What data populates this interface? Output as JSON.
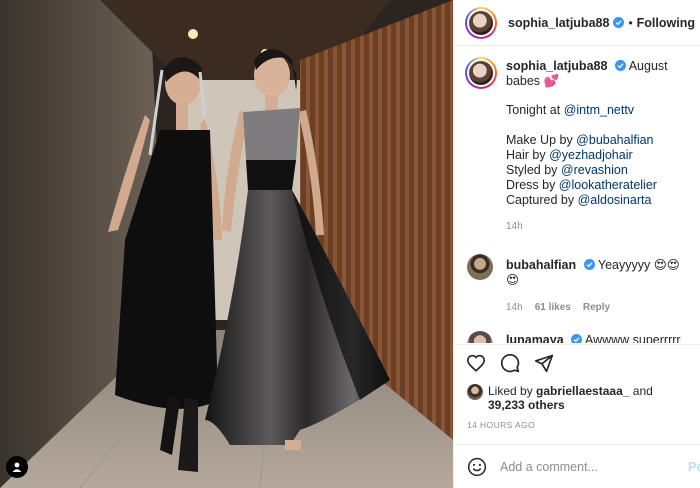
{
  "post": {
    "author": "sophia_latjuba88",
    "follow_status": "Following",
    "separator": "•"
  },
  "caption": {
    "username": "sophia_latjuba88",
    "title": "August babes 💕",
    "line_tonight_prefix": "Tonight at ",
    "line_tonight_mention": "@intm_nettv",
    "credits": [
      {
        "prefix": "Make Up by ",
        "mention": "@bubahalfian"
      },
      {
        "prefix": "Hair by ",
        "mention": "@yezhadjohair"
      },
      {
        "prefix": "Styled by ",
        "mention": "@revashion"
      },
      {
        "prefix": "Dress by ",
        "mention": "@lookatheratelier"
      },
      {
        "prefix": "Captured by ",
        "mention": "@aldosinarta"
      }
    ],
    "age": "14h"
  },
  "comments": [
    {
      "username": "bubahalfian",
      "text": "Yeayyyyy 😍😍😍",
      "age": "14h",
      "likes": "61 likes",
      "reply": "Reply"
    },
    {
      "username": "lunamaya",
      "text": "Awwww superrrrr😍😍 😍😍😍😍"
    }
  ],
  "likes": {
    "prefix": "Liked by ",
    "liker": "gabriellaestaaa_",
    "and": " and",
    "others": "39,233 others"
  },
  "timestamp": "14 HOURS AGO",
  "add_comment": {
    "placeholder": "Add a comment...",
    "post_label": "Po"
  },
  "icons": {
    "verified": "verified-badge-icon",
    "like": "heart-icon",
    "comment": "comment-bubble-icon",
    "share": "paper-plane-icon",
    "emoji": "smiley-icon",
    "tag": "user-tag-icon"
  },
  "colors": {
    "verified_blue": "#3897f0",
    "mention": "#00376b",
    "muted": "#8e8e8e",
    "post_disabled": "#b2dffc"
  }
}
